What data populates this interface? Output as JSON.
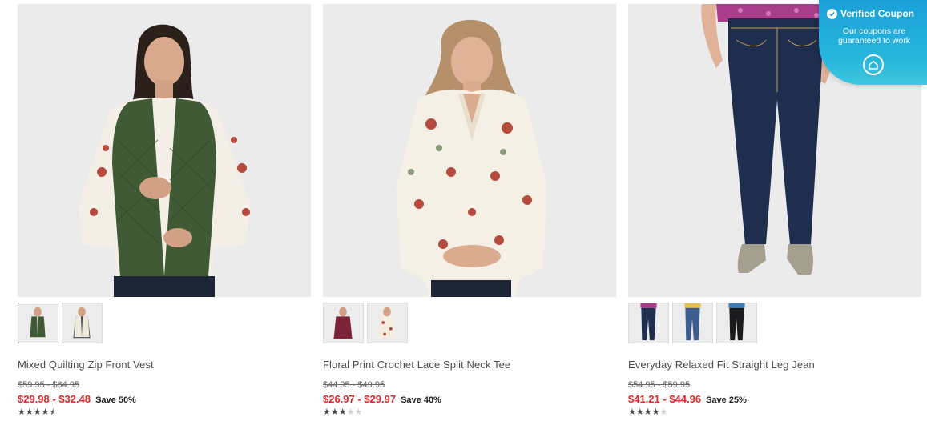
{
  "products": [
    {
      "title": "Mixed Quilting Zip Front Vest",
      "original_price": "$59.95 - $64.95",
      "sale_price": "$29.98 - $32.48",
      "save": "Save 50%",
      "rating": 4.5,
      "thumbnails": [
        "green-vest",
        "cream-vest"
      ]
    },
    {
      "title": "Floral Print Crochet Lace Split Neck Tee",
      "original_price": "$44.95 - $49.95",
      "sale_price": "$26.97 - $29.97",
      "save": "Save 40%",
      "rating": 3,
      "thumbnails": [
        "burgundy-tee",
        "cream-floral-tee"
      ]
    },
    {
      "title": "Everyday Relaxed Fit Straight Leg Jean",
      "original_price": "$54.95 - $59.95",
      "sale_price": "$41.21 - $44.96",
      "save": "Save 25%",
      "rating": 4,
      "thumbnails": [
        "dark-wash-jean",
        "medium-wash-jean",
        "black-jean"
      ]
    }
  ],
  "coupon": {
    "title": "Verified Coupon",
    "subtitle": "Our coupons are guaranteed to work",
    "icon": "home-logo-icon"
  },
  "colors": {
    "sale": "#e3262b",
    "coupon": "#1aa0d8"
  }
}
